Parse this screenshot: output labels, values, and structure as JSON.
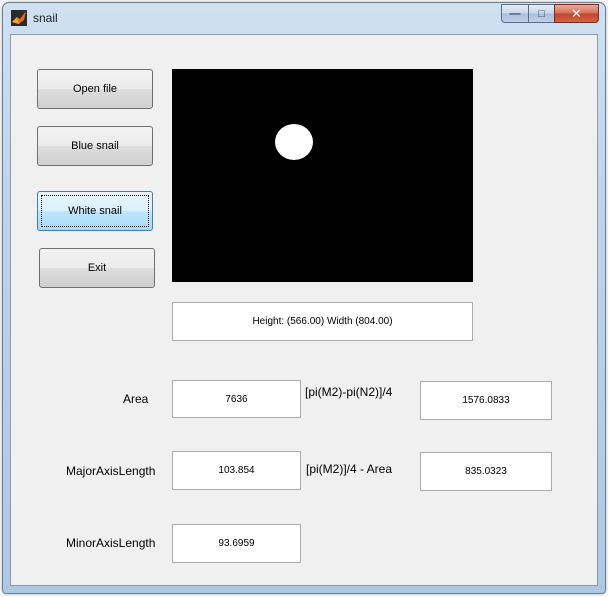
{
  "window": {
    "title": "snail",
    "minimize_glyph": "—",
    "maximize_glyph": "□",
    "close_glyph": "✕"
  },
  "buttons": {
    "open_file": "Open file",
    "blue_snail": "Blue snail",
    "white_snail": "White snail",
    "exit": "Exit"
  },
  "image_info": "Height: (566.00) Width (804.00)",
  "measurements": {
    "area_label": "Area",
    "area_value": "7636",
    "major_axis_label": "MajorAxisLength",
    "major_axis_value": "103.854",
    "minor_axis_label": "MinorAxisLength",
    "minor_axis_value": "93.6959",
    "pi_diff_label": "[pi(M2)-pi(N2)]/4",
    "pi_diff_value": "1576.0833",
    "pi_area_label": "[pi(M2)]/4 - Area",
    "pi_area_value": "835.0323"
  },
  "colors": {
    "axes_background": "#000000",
    "blob": "#ffffff",
    "active_button": "#bee6fd"
  }
}
